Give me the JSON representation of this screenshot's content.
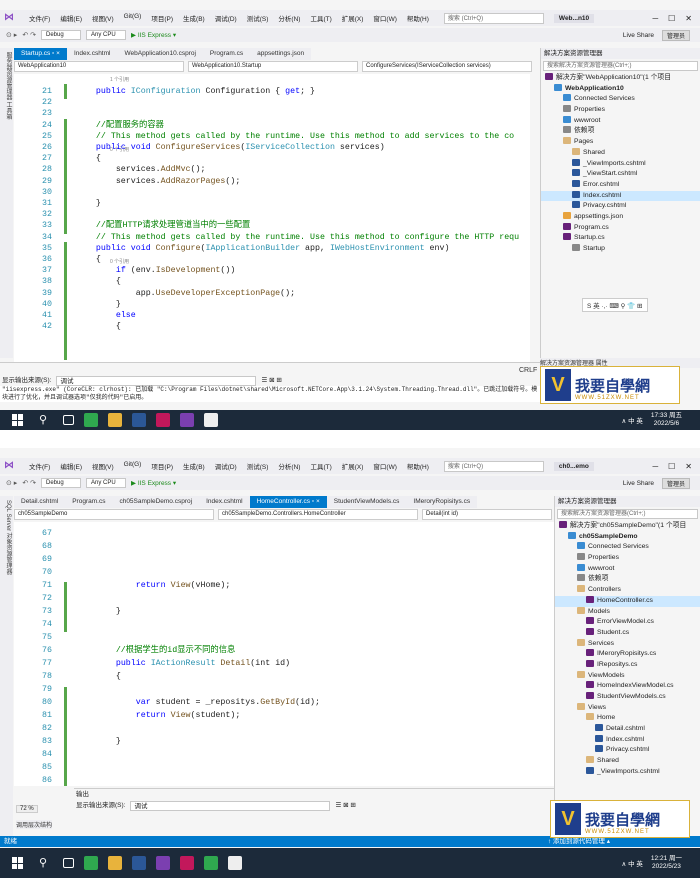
{
  "top": {
    "menu": [
      "文件(F)",
      "编辑(E)",
      "视图(V)",
      "Git(G)",
      "项目(P)",
      "生成(B)",
      "调试(D)",
      "测试(S)",
      "分析(N)",
      "工具(T)",
      "扩展(X)",
      "窗口(W)",
      "帮助(H)"
    ],
    "search_placeholder": "搜索 (Ctrl+Q)",
    "project_name": "Web...n10",
    "toolbar": {
      "config": "Debug",
      "platform": "Any CPU",
      "run": "▶ IIS Express ▾",
      "live_share": "Live Share",
      "manager": "管理员"
    },
    "tabs": [
      {
        "label": "Startup.cs ▫ ×",
        "state": "active"
      },
      {
        "label": "Index.cshtml",
        "state": ""
      },
      {
        "label": "WebApplication10.csproj",
        "state": ""
      },
      {
        "label": "Program.cs",
        "state": ""
      },
      {
        "label": "appsettings.json",
        "state": ""
      }
    ],
    "nav": {
      "project": "WebApplication10",
      "class": "WebApplication10.Startup",
      "member": "ConfigureServices(IServiceCollection services)"
    },
    "left_strip": "服务器资源管理器  工具箱",
    "lines": [
      {
        "n": "21",
        "t": [
          [
            "",
            "    "
          ],
          [
            "kw",
            "public "
          ],
          [
            "ty",
            "IConfiguration"
          ],
          [
            "",
            " Configuration { "
          ],
          [
            "kw",
            "get"
          ],
          [
            "",
            "; }"
          ]
        ]
      },
      {
        "n": "22",
        "t": []
      },
      {
        "n": "23",
        "t": []
      },
      {
        "n": "24",
        "t": [
          [
            "cm",
            "    //配置服务的容器"
          ]
        ]
      },
      {
        "n": "25",
        "t": [
          [
            "cm",
            "    // This method gets called by the runtime. Use this method to add services to the co"
          ]
        ]
      },
      {
        "n": "26",
        "t": [
          [
            "",
            "    "
          ],
          [
            "kw",
            "public void "
          ],
          [
            "mt",
            "ConfigureServices"
          ],
          [
            "",
            "("
          ],
          [
            "ty",
            "IServiceCollection"
          ],
          [
            "",
            " services)"
          ]
        ]
      },
      {
        "n": "27",
        "t": [
          [
            "",
            "    {"
          ]
        ]
      },
      {
        "n": "28",
        "t": [
          [
            "",
            "        services."
          ],
          [
            "mt",
            "AddMvc"
          ],
          [
            "",
            "();"
          ]
        ]
      },
      {
        "n": "29",
        "t": [
          [
            "",
            "        services."
          ],
          [
            "mt",
            "AddRazorPages"
          ],
          [
            "",
            "();"
          ]
        ]
      },
      {
        "n": "30",
        "t": []
      },
      {
        "n": "31",
        "t": [
          [
            "",
            "    }"
          ]
        ]
      },
      {
        "n": "32",
        "t": []
      },
      {
        "n": "33",
        "t": [
          [
            "cm",
            "    //配置HTTP请求处理管道当中的一些配置"
          ]
        ]
      },
      {
        "n": "34",
        "t": [
          [
            "cm",
            "    // This method gets called by the runtime. Use this method to configure the HTTP requ"
          ]
        ]
      },
      {
        "n": "35",
        "t": [
          [
            "",
            "    "
          ],
          [
            "kw",
            "public void "
          ],
          [
            "mt",
            "Configure"
          ],
          [
            "",
            "("
          ],
          [
            "ty",
            "IApplicationBuilder"
          ],
          [
            "",
            " app, "
          ],
          [
            "ty",
            "IWebHostEnvironment"
          ],
          [
            "",
            " env)"
          ]
        ]
      },
      {
        "n": "36",
        "t": [
          [
            "",
            "    {"
          ]
        ]
      },
      {
        "n": "37",
        "t": [
          [
            "",
            "        "
          ],
          [
            "kw",
            "if"
          ],
          [
            "",
            " (env."
          ],
          [
            "mt",
            "IsDevelopment"
          ],
          [
            "",
            "())"
          ]
        ]
      },
      {
        "n": "38",
        "t": [
          [
            "",
            "        {"
          ]
        ]
      },
      {
        "n": "39",
        "t": [
          [
            "",
            "            app."
          ],
          [
            "mt",
            "UseDeveloperExceptionPage"
          ],
          [
            "",
            "();"
          ]
        ]
      },
      {
        "n": "40",
        "t": [
          [
            "",
            "        }"
          ]
        ]
      },
      {
        "n": "41",
        "t": [
          [
            "",
            "        "
          ],
          [
            "kw",
            "else"
          ]
        ]
      },
      {
        "n": "42",
        "t": [
          [
            "",
            "        {"
          ]
        ]
      }
    ],
    "refs": [
      "1 个引用",
      "0 个引用",
      "0 个引用"
    ],
    "solution": {
      "title": "解决方案资源管理器",
      "search": "搜索解决方案资源管理器(Ctrl+;)",
      "nodes": [
        {
          "label": "解决方案\"WebApplication10\"(1 个项目",
          "i": "sln",
          "d": 0,
          "b": false
        },
        {
          "label": "WebApplication10",
          "i": "glob",
          "d": 1,
          "b": true
        },
        {
          "label": "Connected Services",
          "i": "glob",
          "d": 2,
          "b": false
        },
        {
          "label": "Properties",
          "i": "gear",
          "d": 2,
          "b": false
        },
        {
          "label": "wwwroot",
          "i": "glob",
          "d": 2,
          "b": false
        },
        {
          "label": "依赖项",
          "i": "gear",
          "d": 2,
          "b": false
        },
        {
          "label": "Pages",
          "i": "f",
          "d": 2,
          "b": false
        },
        {
          "label": "Shared",
          "i": "f",
          "d": 3,
          "b": false
        },
        {
          "label": "_ViewImports.cshtml",
          "i": "cshtml",
          "d": 3,
          "b": false
        },
        {
          "label": "_ViewStart.cshtml",
          "i": "cshtml",
          "d": 3,
          "b": false
        },
        {
          "label": "Error.cshtml",
          "i": "cshtml",
          "d": 3,
          "b": false
        },
        {
          "label": "Index.cshtml",
          "i": "cshtml",
          "d": 3,
          "b": false,
          "sel": true
        },
        {
          "label": "Privacy.cshtml",
          "i": "cshtml",
          "d": 3,
          "b": false
        },
        {
          "label": "appsettings.json",
          "i": "json",
          "d": 2,
          "b": false
        },
        {
          "label": "Program.cs",
          "i": "cs",
          "d": 2,
          "b": false
        },
        {
          "label": "Startup.cs",
          "i": "cs",
          "d": 2,
          "b": false
        },
        {
          "label": "Startup",
          "i": "gear",
          "d": 3,
          "b": false
        }
      ],
      "bottom_tabs": "解决方案资源管理器  属性"
    },
    "output": {
      "label": "显示输出来源(S):",
      "source": "调试",
      "log1": "\"iisexpress.exe\" (CoreCLR: clrhost): 已加载 \"C:\\Program Files\\dotnet\\shared\\Microsoft.NETCore.App\\3.1.24\\System.Threading.Thread.dll\"。已跳过加载符号。模",
      "log2": "块进行了优化，并且调试器选项\"仅我的代码\"已启用。"
    },
    "crlf": "CRLF",
    "clock_time": "17:33 周五",
    "clock_date": "2022/5/6",
    "tray": "∧  中  英"
  },
  "bottom": {
    "project_name": "ch0...emo",
    "tabs": [
      {
        "label": "Detail.cshtml",
        "state": ""
      },
      {
        "label": "Program.cs",
        "state": ""
      },
      {
        "label": "ch05SampleDemo.csproj",
        "state": ""
      },
      {
        "label": "Index.cshtml",
        "state": ""
      },
      {
        "label": "HomeController.cs ▫ ×",
        "state": "active"
      },
      {
        "label": "StudentViewModels.cs",
        "state": ""
      },
      {
        "label": "IMeroryRopisitys.cs",
        "state": ""
      }
    ],
    "nav": {
      "project": "ch05SampleDemo",
      "class": "ch05SampleDemo.Controllers.HomeController",
      "member": "Detail(int id)"
    },
    "left_strip": "SQL Server 对象资源管理器",
    "lines": [
      {
        "n": "67",
        "t": []
      },
      {
        "n": "68",
        "t": []
      },
      {
        "n": "69",
        "t": []
      },
      {
        "n": "70",
        "t": []
      },
      {
        "n": "71",
        "t": [
          [
            "",
            "            "
          ],
          [
            "kw",
            "return "
          ],
          [
            "mt",
            "View"
          ],
          [
            "",
            "(vHome);"
          ]
        ]
      },
      {
        "n": "72",
        "t": []
      },
      {
        "n": "73",
        "t": [
          [
            "",
            "        }"
          ]
        ]
      },
      {
        "n": "74",
        "t": []
      },
      {
        "n": "75",
        "t": []
      },
      {
        "n": "76",
        "t": [
          [
            "cm",
            "        //根据学生的id显示不同的信息"
          ]
        ]
      },
      {
        "n": "77",
        "t": [
          [
            "",
            "        "
          ],
          [
            "kw",
            "public "
          ],
          [
            "ty",
            "IActionResult"
          ],
          [
            "",
            " "
          ],
          [
            "mt",
            "Detail"
          ],
          [
            "",
            "(int id)"
          ]
        ]
      },
      {
        "n": "78",
        "t": [
          [
            "",
            "        {"
          ]
        ]
      },
      {
        "n": "79",
        "t": []
      },
      {
        "n": "80",
        "t": [
          [
            "",
            "            "
          ],
          [
            "kw",
            "var"
          ],
          [
            "",
            " student = _repositys."
          ],
          [
            "mt",
            "GetById"
          ],
          [
            "",
            "(id);"
          ]
        ]
      },
      {
        "n": "81",
        "t": [
          [
            "",
            "            "
          ],
          [
            "kw",
            "return "
          ],
          [
            "mt",
            "View"
          ],
          [
            "",
            "(student);"
          ]
        ]
      },
      {
        "n": "82",
        "t": []
      },
      {
        "n": "83",
        "t": [
          [
            "",
            "        }"
          ]
        ]
      },
      {
        "n": "84",
        "t": []
      },
      {
        "n": "85",
        "t": []
      },
      {
        "n": "86",
        "t": []
      }
    ],
    "solution": {
      "title": "解决方案资源管理器",
      "search": "搜索解决方案资源管理器(Ctrl+;)",
      "nodes": [
        {
          "label": "解决方案\"ch05SampleDemo\"(1 个项目",
          "i": "sln",
          "d": 0,
          "b": false
        },
        {
          "label": "ch05SampleDemo",
          "i": "glob",
          "d": 1,
          "b": true
        },
        {
          "label": "Connected Services",
          "i": "glob",
          "d": 2,
          "b": false
        },
        {
          "label": "Properties",
          "i": "gear",
          "d": 2,
          "b": false
        },
        {
          "label": "wwwroot",
          "i": "glob",
          "d": 2,
          "b": false
        },
        {
          "label": "依赖项",
          "i": "gear",
          "d": 2,
          "b": false
        },
        {
          "label": "Controllers",
          "i": "f",
          "d": 2,
          "b": false
        },
        {
          "label": "HomeController.cs",
          "i": "cs",
          "d": 3,
          "b": false,
          "sel": true
        },
        {
          "label": "Models",
          "i": "f",
          "d": 2,
          "b": false
        },
        {
          "label": "ErrorViewModel.cs",
          "i": "cs",
          "d": 3,
          "b": false
        },
        {
          "label": "Student.cs",
          "i": "cs",
          "d": 3,
          "b": false
        },
        {
          "label": "Services",
          "i": "f",
          "d": 2,
          "b": false
        },
        {
          "label": "IMeroryRopisitys.cs",
          "i": "cs",
          "d": 3,
          "b": false
        },
        {
          "label": "IRepositys.cs",
          "i": "cs",
          "d": 3,
          "b": false
        },
        {
          "label": "ViewModels",
          "i": "f",
          "d": 2,
          "b": false
        },
        {
          "label": "HomeIndexViewModel.cs",
          "i": "cs",
          "d": 3,
          "b": false
        },
        {
          "label": "StudentViewModels.cs",
          "i": "cs",
          "d": 3,
          "b": false
        },
        {
          "label": "Views",
          "i": "f",
          "d": 2,
          "b": false
        },
        {
          "label": "Home",
          "i": "f",
          "d": 3,
          "b": false
        },
        {
          "label": "Detail.cshtml",
          "i": "cshtml",
          "d": 4,
          "b": false
        },
        {
          "label": "Index.cshtml",
          "i": "cshtml",
          "d": 4,
          "b": false
        },
        {
          "label": "Privacy.cshtml",
          "i": "cshtml",
          "d": 4,
          "b": false
        },
        {
          "label": "Shared",
          "i": "f",
          "d": 3,
          "b": false
        },
        {
          "label": "_ViewImports.cshtml",
          "i": "cshtml",
          "d": 3,
          "b": false
        }
      ]
    },
    "output": {
      "title": "输出",
      "label": "显示输出来源(S):",
      "source": "调试"
    },
    "zoom": "72 %",
    "bottom_left": "调用层次结构",
    "status": "就绪",
    "status_right": "↑ 添加到源代码管理 ▴",
    "clock_time": "12:21 周一",
    "clock_date": "2022/5/23",
    "tray": "∧  中  英"
  },
  "logo": {
    "mark": "V",
    "text": "我要自學網",
    "url": "WWW.51ZXW.NET"
  },
  "ime": "S 英 ·,· ⌨ ⚲ 👕 ⊞",
  "colors": {
    "accent": "#007acc",
    "taskbar": "#1c2a3a",
    "vs_purple": "#68217a"
  }
}
